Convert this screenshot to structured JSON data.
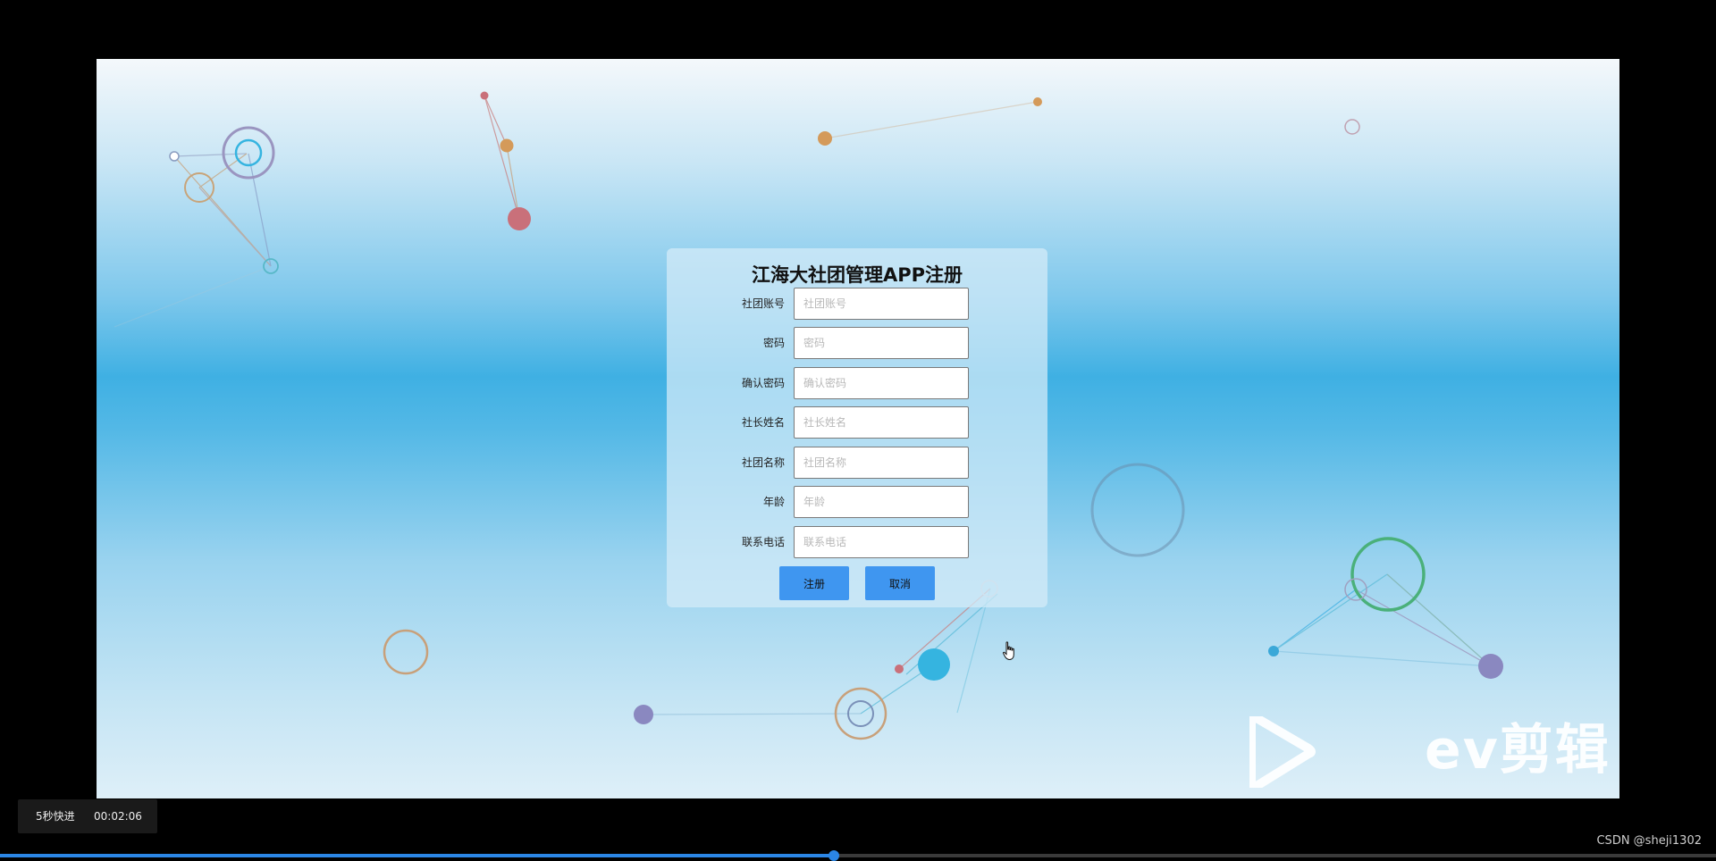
{
  "form": {
    "title": "江海大社团管理APP注册",
    "fields": [
      {
        "label": "社团账号",
        "placeholder": "社团账号",
        "value": ""
      },
      {
        "label": "密码",
        "placeholder": "密码",
        "value": ""
      },
      {
        "label": "确认密码",
        "placeholder": "确认密码",
        "value": ""
      },
      {
        "label": "社长姓名",
        "placeholder": "社长姓名",
        "value": ""
      },
      {
        "label": "社团名称",
        "placeholder": "社团名称",
        "value": ""
      },
      {
        "label": "年龄",
        "placeholder": "年龄",
        "value": ""
      },
      {
        "label": "联系电话",
        "placeholder": "联系电话",
        "value": ""
      }
    ],
    "register_label": "注册",
    "cancel_label": "取消"
  },
  "watermark": {
    "text": "ev剪辑"
  },
  "player": {
    "speed_label": "5秒快进",
    "time": "00:02:06",
    "progress_percent": 48.6
  },
  "credit": "CSDN @sheji1302",
  "colors": {
    "button": "#3f96f0",
    "progress": "#2b86e6"
  },
  "icons": {
    "cursor": "hand-pointer-icon",
    "watermark_logo": "play-triangle-icon"
  }
}
